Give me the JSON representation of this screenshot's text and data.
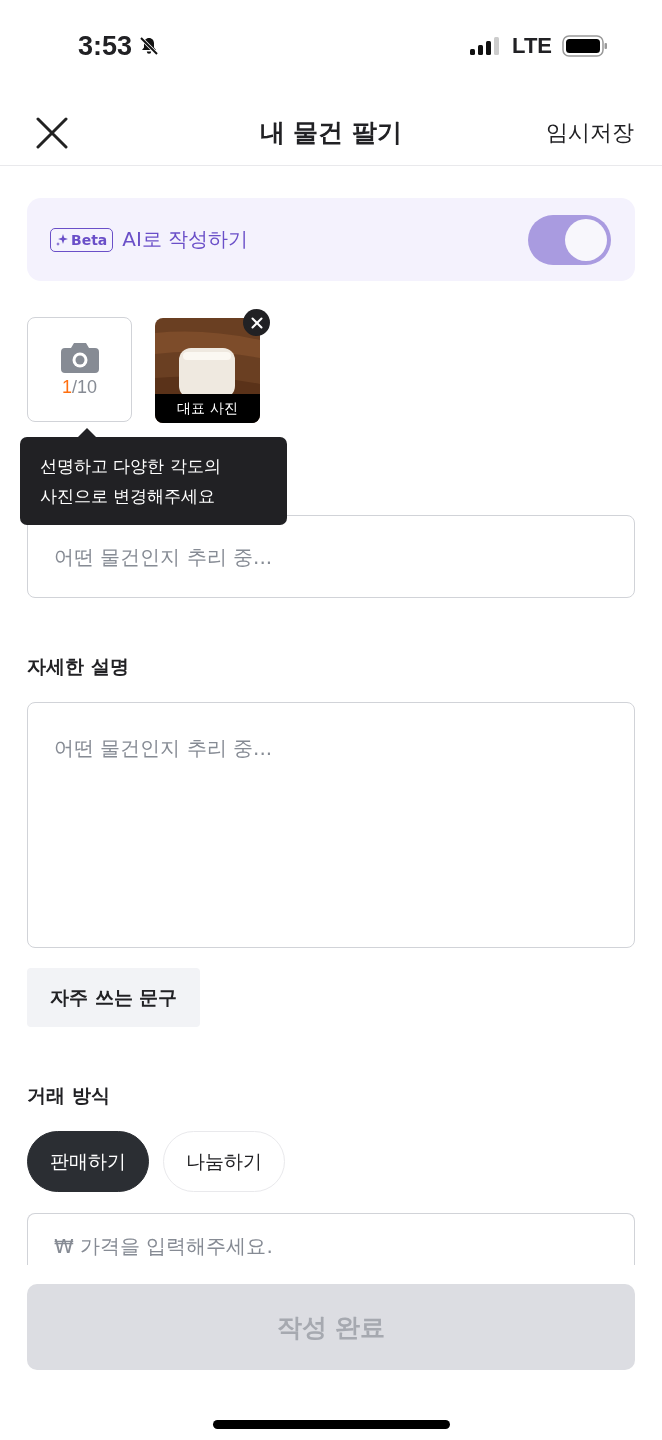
{
  "status_bar": {
    "time": "3:53",
    "network": "LTE"
  },
  "header": {
    "title": "내 물건 팔기",
    "action": "임시저장"
  },
  "ai_card": {
    "badge": "Beta",
    "label": "AI로 작성하기",
    "on": true
  },
  "photos": {
    "count": "1",
    "limit": "/10",
    "items": [
      {
        "kind": "picture",
        "caption": "대표 사진"
      }
    ]
  },
  "tooltip": "선명하고 다양한 각도의\n사진으로 변경해주세요",
  "title_field": {
    "placeholder": "어떤 물건인지 추리 중..."
  },
  "description": {
    "label": "자세한 설명",
    "placeholder": "어떤 물건인지 추리 중..."
  },
  "phrases_button": "자주 쓰는 문구",
  "trade": {
    "label": "거래 방식",
    "options": [
      {
        "label": "판매하기",
        "selected": true
      },
      {
        "label": "나눔하기",
        "selected": false
      }
    ]
  },
  "price_field": {
    "placeholder": "₩ 가격을 입력해주세요."
  },
  "submit": {
    "label": "작성 완료",
    "disabled": true
  }
}
